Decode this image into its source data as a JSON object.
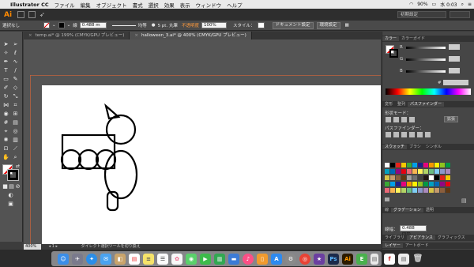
{
  "menubar": {
    "app": "Illustrator CC",
    "items": [
      "ファイル",
      "編集",
      "オブジェクト",
      "書式",
      "選択",
      "効果",
      "表示",
      "ウィンドウ",
      "ヘルプ"
    ],
    "battery": "90%",
    "clock": "水 0:03"
  },
  "appbar": {
    "logo": "Ai",
    "workspace": "初期設定"
  },
  "control": {
    "selection": "選択なし",
    "stroke_label": "線",
    "stroke_weight": "0.488 m",
    "profile": "均等",
    "brush": "5 pt. 丸筆",
    "opacity_label": "不透明度",
    "opacity": "100%",
    "style_label": "スタイル：",
    "doc_setup": "ドキュメント設定",
    "prefs": "環境設定"
  },
  "tabs": [
    {
      "label": "temp.ai* @ 199% (CMYK/GPU プレビュー)",
      "active": false
    },
    {
      "label": "halloween_3.ai* @ 400% (CMYK/GPU プレビュー)",
      "active": true
    }
  ],
  "status": {
    "zoom": "400%",
    "tool": "ダイレクト選択ツールを切り換え"
  },
  "panels": {
    "color": {
      "tabs": [
        "カラー",
        "カラーガイド"
      ],
      "channels": [
        "R",
        "G",
        "B"
      ],
      "hex": "#"
    },
    "pathfinder": {
      "tabs": [
        "変形",
        "整列",
        "パスファインダー"
      ],
      "shape_modes": "形状モード：",
      "pathfinder": "パスファインダー：",
      "expand": "拡張"
    },
    "swatches": {
      "tabs": [
        "スウォッチ",
        "ブラシ",
        "シンボル"
      ]
    },
    "gradient": {
      "tabs": [
        "線",
        "グラデーション",
        "透明"
      ],
      "weight_label": "線幅：",
      "weight": "0.488 mm"
    },
    "layers": {
      "tabs": [
        "ライブラリ",
        "アピアランス",
        "グラフィックス"
      ],
      "tabs2": [
        "レイヤー",
        "アートボード"
      ]
    }
  },
  "swatch_colors": [
    "#ffffff",
    "#000000",
    "#e4231b",
    "#f7c800",
    "#3aa935",
    "#00a0e9",
    "#1d2088",
    "#e5007f",
    "#f39800",
    "#fff100",
    "#8fc31f",
    "#009944",
    "#00a0c1",
    "#0068b7",
    "#920783",
    "#e60012",
    "#eb6877",
    "#f8b551",
    "#fff45c",
    "#b3d465",
    "#69bd83",
    "#7ecef4",
    "#8c97cb",
    "#aa89bd",
    "#d7c447",
    "#c49a6c",
    "#8b5e3c",
    "#603813",
    "#a0a0a0",
    "#707070",
    "#404040",
    "#231815"
  ]
}
